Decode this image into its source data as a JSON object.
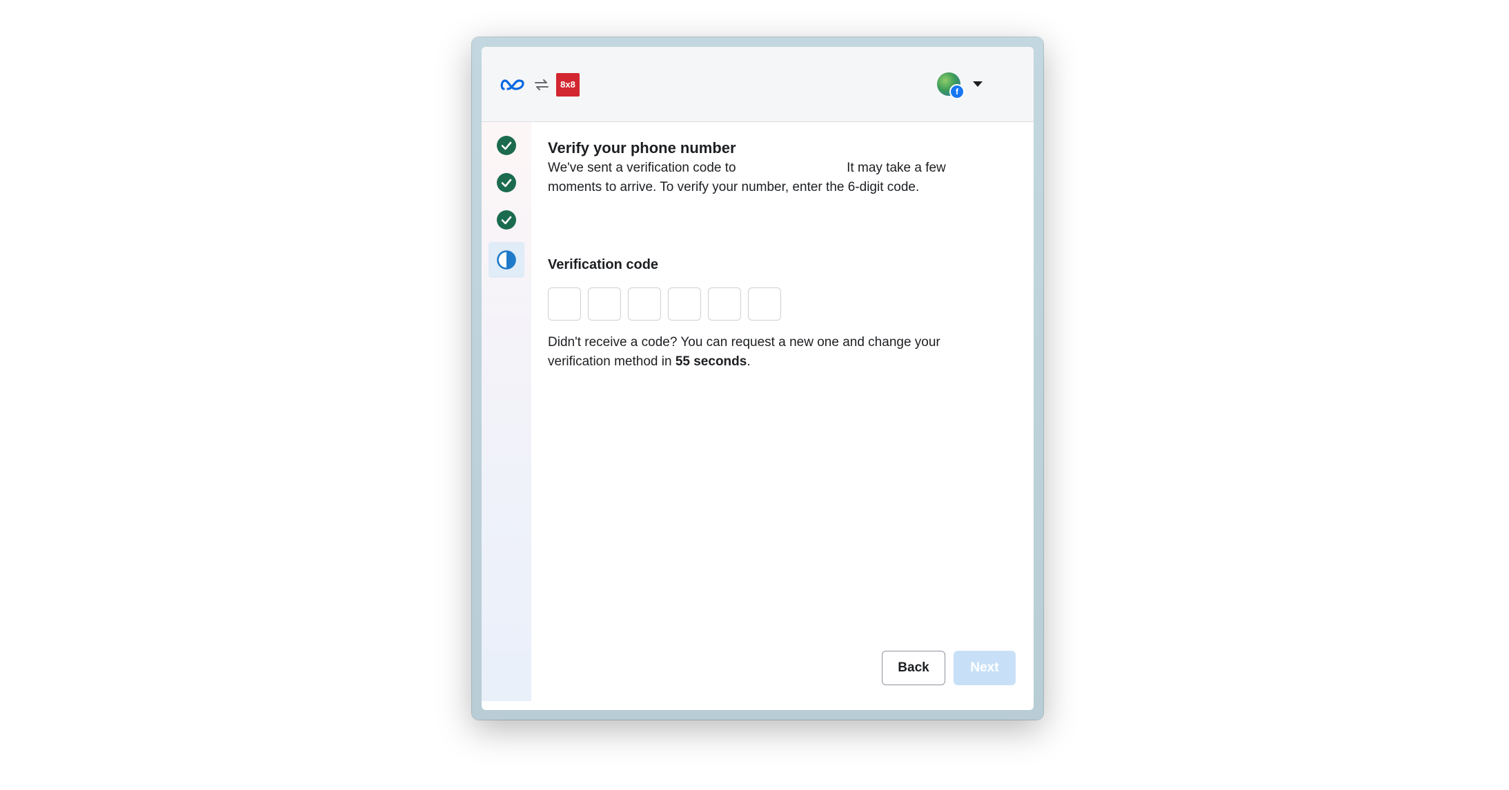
{
  "header": {
    "brand_logo_text": "8x8",
    "brand_color": "#d22630",
    "meta_logo_color": "#0668e1",
    "fb_badge_text": "f"
  },
  "steps": [
    {
      "status": "complete",
      "icon": "check-circle-icon"
    },
    {
      "status": "complete",
      "icon": "check-circle-icon"
    },
    {
      "status": "complete",
      "icon": "check-circle-icon"
    },
    {
      "status": "in-progress",
      "icon": "half-circle-icon"
    }
  ],
  "main": {
    "title": "Verify your phone number",
    "description_part1": "We've sent a verification code to",
    "description_part2": "It may take a few moments to arrive. To verify your number, enter the 6-digit code.",
    "code_label": "Verification code",
    "code_digits": [
      "",
      "",
      "",
      "",
      "",
      ""
    ],
    "resend_prefix": "Didn't receive a code? You can request a new one and change your verification method in ",
    "resend_countdown": "55 seconds",
    "resend_suffix": "."
  },
  "footer": {
    "back_label": "Back",
    "next_label": "Next"
  },
  "colors": {
    "check_green": "#1b6b4f",
    "in_progress_blue": "#1f7ac9",
    "next_disabled": "#c8e0f7"
  }
}
